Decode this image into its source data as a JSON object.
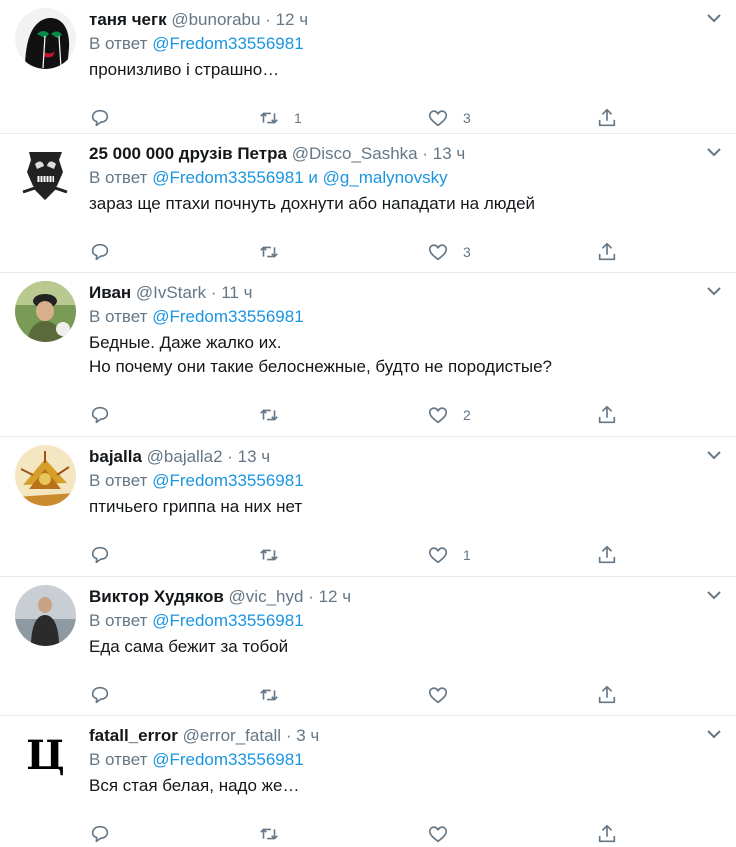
{
  "reply_prefix": "В ответ",
  "tweets": [
    {
      "name": "таня чегк",
      "handle": "@bunorabu",
      "time": "12 ч",
      "mentions": "@Fredom33556981",
      "text_lines": [
        "пронизливо і страшно…"
      ],
      "reply_count": "",
      "retweet_count": "1",
      "like_count": "3"
    },
    {
      "name": "25 000 000 друзів Петра",
      "handle": "@Disco_Sashka",
      "time": "13 ч",
      "mentions": "@Fredom33556981 и @g_malynovsky",
      "text_lines": [
        "зараз ще птахи почнуть дохнути або нападати на людей"
      ],
      "reply_count": "",
      "retweet_count": "",
      "like_count": "3"
    },
    {
      "name": "Иван",
      "handle": "@IvStark",
      "time": "11 ч",
      "mentions": "@Fredom33556981",
      "text_lines": [
        "Бедные. Даже жалко их.",
        "Но почему они такие белоснежные, будто не породистые?"
      ],
      "reply_count": "",
      "retweet_count": "",
      "like_count": "2"
    },
    {
      "name": "bajalla",
      "handle": "@bajalla2",
      "time": "13 ч",
      "mentions": "@Fredom33556981",
      "text_lines": [
        "птичьего гриппа на них нет"
      ],
      "reply_count": "",
      "retweet_count": "",
      "like_count": "1"
    },
    {
      "name": "Виктор Худяков",
      "handle": "@vic_hyd",
      "time": "12 ч",
      "mentions": "@Fredom33556981",
      "text_lines": [
        "Еда сама бежит за тобой"
      ],
      "reply_count": "",
      "retweet_count": "",
      "like_count": ""
    },
    {
      "name": "fatall_error",
      "handle": "@error_fatall",
      "time": "3 ч",
      "mentions": "@Fredom33556981",
      "text_lines": [
        "Вся стая белая, надо же…"
      ],
      "reply_count": "",
      "retweet_count": "",
      "like_count": ""
    }
  ],
  "avatar_logo_letter": "Ц",
  "colors": {
    "link": "#1b95e0",
    "muted": "#657786",
    "text": "#14171a",
    "divider": "#e6ecf0"
  },
  "icons": [
    "chevron-down-icon",
    "reply-icon",
    "retweet-icon",
    "like-icon",
    "share-icon"
  ]
}
